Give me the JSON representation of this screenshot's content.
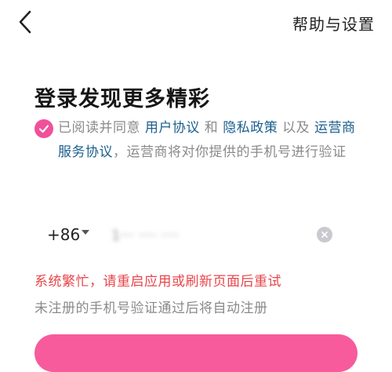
{
  "header": {
    "back_icon": "chevron-left-icon",
    "help_settings": "帮助与设置"
  },
  "title": "登录发现更多精彩",
  "agreement": {
    "checked": true,
    "check_color": "#f0509a",
    "prefix": "已阅读并同意 ",
    "user_agreement": "用户协议",
    "and": " 和 ",
    "privacy_policy": "隐私政策",
    "and_also": " 以及 ",
    "carrier_agreement": "运营商服务协议",
    "suffix": "，运营商将对你提供的手机号进行验证",
    "link_color": "#1a5f8e"
  },
  "phone": {
    "country_code": "+86",
    "value": "1‧‧‧ ‧‧‧‧ ‧‧‧‧",
    "clear_icon": "clear-circle-icon"
  },
  "error_message": "系统繁忙，请重启应用或刷新页面后重试",
  "hint": "未注册的手机号验证通过后将自动注册",
  "login_button": {
    "color": "#f75b9c"
  }
}
